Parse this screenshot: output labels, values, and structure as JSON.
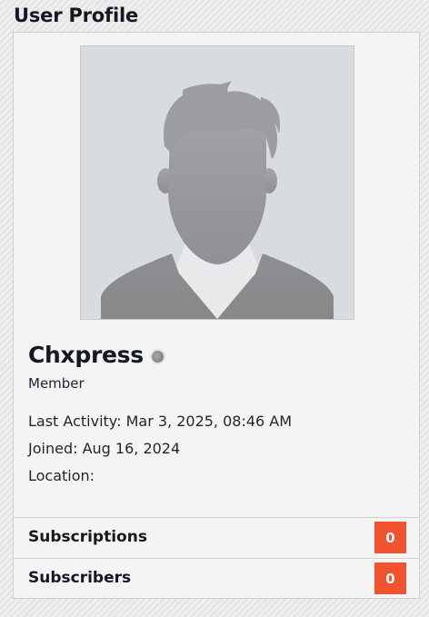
{
  "section": {
    "title": "User Profile"
  },
  "profile": {
    "avatar_icon": "default-user-avatar-icon",
    "username": "Chxpress",
    "status_indicator": "offline-status-icon",
    "role": "Member",
    "last_activity_label": "Last Activity:",
    "last_activity_value": "Mar 3, 2025, 08:46 AM",
    "joined_label": "Joined:",
    "joined_value": "Aug 16, 2024",
    "location_label": "Location:",
    "location_value": ""
  },
  "stats": [
    {
      "label": "Subscriptions",
      "count": "0"
    },
    {
      "label": "Subscribers",
      "count": "0"
    }
  ],
  "colors": {
    "badge": "#f0532e",
    "card_background": "#f4f4f4",
    "avatar_background": "#d9dcdf",
    "avatar_silhouette": "#9a9c9f"
  }
}
